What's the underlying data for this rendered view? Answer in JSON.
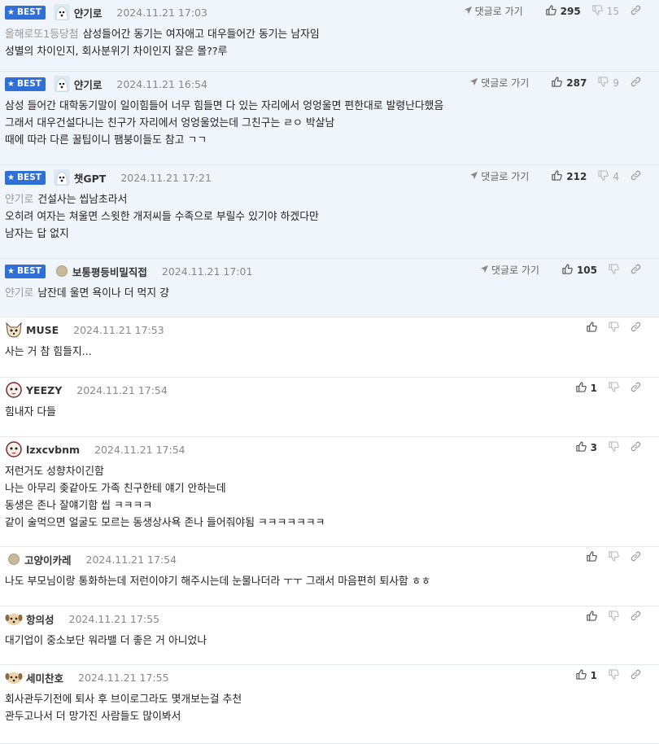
{
  "labels": {
    "best": "BEST",
    "reply": "댓글로 가기"
  },
  "comments": [
    {
      "best": true,
      "avatar": "dog-icon",
      "nick": "얀기로",
      "date": "2024.11.21 17:03",
      "up": "295",
      "down": "15",
      "lines": [
        {
          "tag": "올해로또1등당첨",
          "text": "삼성들어간 동기는 여자애고 대우들어간 동기는 남자임"
        },
        {
          "tag": "",
          "text": "성별의 차이인지, 회사분위기 차이인지 잘은 몰??루"
        }
      ]
    },
    {
      "best": true,
      "avatar": "dog-icon",
      "nick": "얀기로",
      "date": "2024.11.21 16:54",
      "up": "287",
      "down": "9",
      "lines": [
        {
          "tag": "",
          "text": "삼성 들어간 대학동기말이 일이힘들어 너무 힘들면 다 있는 자리에서 엉엉울면 편한대로 발령난다했음"
        },
        {
          "tag": "",
          "text": "그래서 대우건설다니는 친구가 자리에서 엉엉울었는데 그친구는 ㄹㅇ 박살남"
        },
        {
          "tag": "",
          "text": "때에 따라 다른 꿀팁이니 팸붕이들도 참고 ㄱㄱ"
        }
      ]
    },
    {
      "best": true,
      "avatar": "dog-icon",
      "nick": "챗GPT",
      "date": "2024.11.21 17:21",
      "up": "212",
      "down": "4",
      "lines": [
        {
          "tag": "얀기로",
          "text": "건설사는 씹남초라서"
        },
        {
          "tag": "",
          "text": "오히려 여자는 쳐울면 스윗한 개저씨들 수족으로 부릴수 있기야 하겠다만"
        },
        {
          "tag": "",
          "text": "남자는 답 없지"
        }
      ]
    },
    {
      "best": true,
      "avatar": "dot",
      "nick": "보통평등비밀직접",
      "date": "2024.11.21 17:01",
      "up": "105",
      "down": "",
      "lines": [
        {
          "tag": "얀기로",
          "text": "남잔데 울면 욕이나 더 먹지 걍"
        }
      ]
    },
    {
      "best": false,
      "avatar": "fox-icon",
      "nick": "MUSE",
      "date": "2024.11.21 17:53",
      "up": "",
      "down": "",
      "lines": [
        {
          "tag": "",
          "text": "사는 거 참 힘들지..."
        }
      ]
    },
    {
      "best": false,
      "avatar": "pup-icon",
      "nick": "YEEZY",
      "date": "2024.11.21 17:54",
      "up": "1",
      "down": "",
      "lines": [
        {
          "tag": "",
          "text": "힘내자 다들"
        }
      ]
    },
    {
      "best": false,
      "avatar": "pup-icon",
      "nick": "lzxcvbnm",
      "date": "2024.11.21 17:54",
      "up": "3",
      "down": "",
      "lines": [
        {
          "tag": "",
          "text": "저런거도 성향차이긴함"
        },
        {
          "tag": "",
          "text": "나는 아무리 좆같아도 가족 친구한테 얘기 안하는데"
        },
        {
          "tag": "",
          "text": "동생은 존나 잘얘기함 씹 ㅋㅋㅋㅋ"
        },
        {
          "tag": "",
          "text": "같이 술먹으면 얼굴도 모르는 동생상사욕 존나 들어줘야됨 ㅋㅋㅋㅋㅋㅋㅋ"
        }
      ]
    },
    {
      "best": false,
      "avatar": "dot",
      "nick": "고양이카레",
      "date": "2024.11.21 17:54",
      "up": "",
      "down": "",
      "lines": [
        {
          "tag": "",
          "text": "나도 부모님이랑 통화하는데 저런이야기 해주시는데 눈물나더라 ㅜㅜ 그래서 마음편히 퇴사함 ㅎㅎ"
        }
      ]
    },
    {
      "best": false,
      "avatar": "dog2-icon",
      "nick": "항의성",
      "date": "2024.11.21 17:55",
      "up": "",
      "down": "",
      "lines": [
        {
          "tag": "",
          "text": "대기업이 중소보단 워라밸 더 좋은 거 아니었나"
        }
      ]
    },
    {
      "best": false,
      "avatar": "dog2-icon",
      "nick": "세미찬호",
      "date": "2024.11.21 17:55",
      "up": "1",
      "down": "",
      "lines": [
        {
          "tag": "",
          "text": "회사관두기전에 퇴사 후 브이로그라도 몇개보는걸 추천"
        },
        {
          "tag": "",
          "text": "관두고나서 더 망가진 사람들도 많이봐서"
        }
      ]
    }
  ]
}
